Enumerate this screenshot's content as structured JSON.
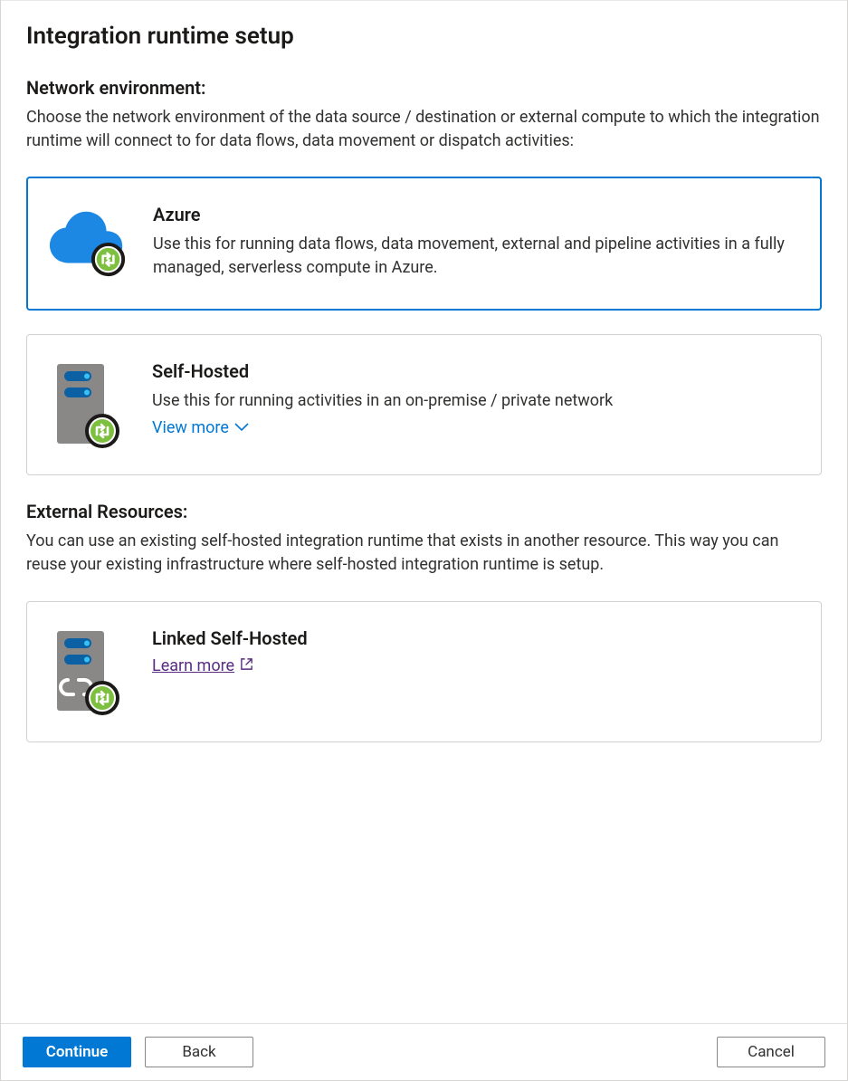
{
  "page": {
    "title": "Integration runtime setup"
  },
  "sections": {
    "network": {
      "title": "Network environment:",
      "description": "Choose the network environment of the data source / destination or external compute to which the integration runtime will connect to for data flows, data movement or dispatch activities:"
    },
    "external": {
      "title": "External Resources:",
      "description": "You can use an existing self-hosted integration runtime that exists in another resource. This way you can reuse your existing infrastructure where self-hosted integration runtime is setup."
    }
  },
  "cards": {
    "azure": {
      "title": "Azure",
      "description": "Use this for running data flows, data movement, external and pipeline activities in a fully managed, serverless compute in Azure.",
      "selected": true
    },
    "self_hosted": {
      "title": "Self-Hosted",
      "description": "Use this for running activities in an on-premise / private network",
      "view_more_label": "View more",
      "selected": false
    },
    "linked_self_hosted": {
      "title": "Linked Self-Hosted",
      "learn_more_label": "Learn more",
      "selected": false
    }
  },
  "footer": {
    "continue_label": "Continue",
    "back_label": "Back",
    "cancel_label": "Cancel"
  },
  "colors": {
    "primary": "#0078d4",
    "link_visited": "#5a2d82",
    "cloud": "#1d87e4",
    "server_body": "#8a8887",
    "server_slot": "#0b61a4",
    "server_led": "#37c2f1",
    "badge_green": "#7dbf3f"
  }
}
